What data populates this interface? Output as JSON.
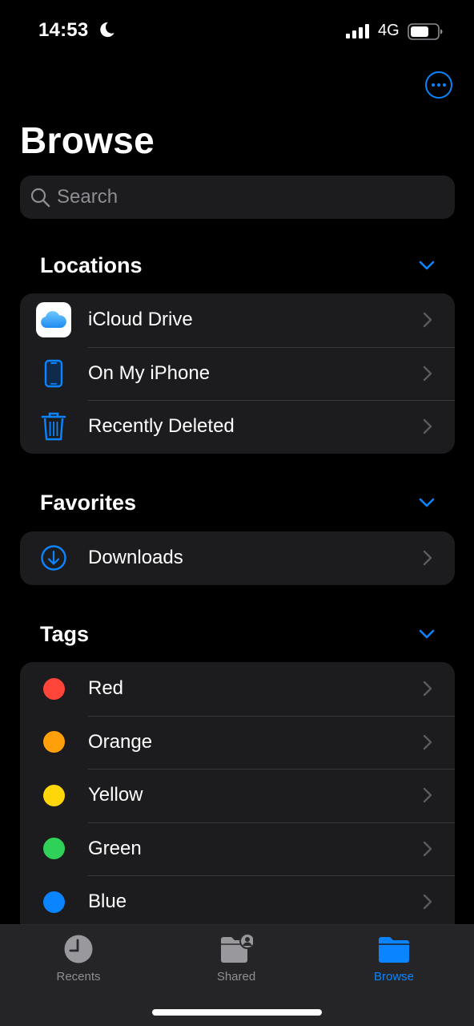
{
  "status_bar": {
    "time": "14:53",
    "focus_icon": "moon-icon",
    "signal_icon": "cellular-signal-icon",
    "network": "4G",
    "battery_icon": "battery-icon"
  },
  "header": {
    "more_icon": "ellipsis-circle-icon",
    "title": "Browse"
  },
  "search": {
    "placeholder": "Search",
    "value": ""
  },
  "colors": {
    "accent": "#0a84ff",
    "background": "#000000",
    "grouped_cell": "#1c1c1e",
    "secondary_text": "#8e8e93"
  },
  "sections": {
    "locations": {
      "title": "Locations",
      "collapse_icon": "chevron-down-icon",
      "items": [
        {
          "label": "iCloud Drive",
          "icon": "icloud-drive-icon"
        },
        {
          "label": "On My iPhone",
          "icon": "iphone-icon"
        },
        {
          "label": "Recently Deleted",
          "icon": "trash-icon"
        }
      ]
    },
    "favorites": {
      "title": "Favorites",
      "collapse_icon": "chevron-down-icon",
      "items": [
        {
          "label": "Downloads",
          "icon": "download-circle-icon"
        }
      ]
    },
    "tags": {
      "title": "Tags",
      "collapse_icon": "chevron-down-icon",
      "items": [
        {
          "label": "Red",
          "color": "#ff453a"
        },
        {
          "label": "Orange",
          "color": "#ff9f0a"
        },
        {
          "label": "Yellow",
          "color": "#ffd60a"
        },
        {
          "label": "Green",
          "color": "#30d158"
        },
        {
          "label": "Blue",
          "color": "#0a84ff"
        }
      ]
    }
  },
  "tab_bar": {
    "tabs": [
      {
        "label": "Recents",
        "icon": "clock-icon",
        "active": false
      },
      {
        "label": "Shared",
        "icon": "shared-folder-icon",
        "active": false
      },
      {
        "label": "Browse",
        "icon": "folder-icon",
        "active": true
      }
    ]
  }
}
